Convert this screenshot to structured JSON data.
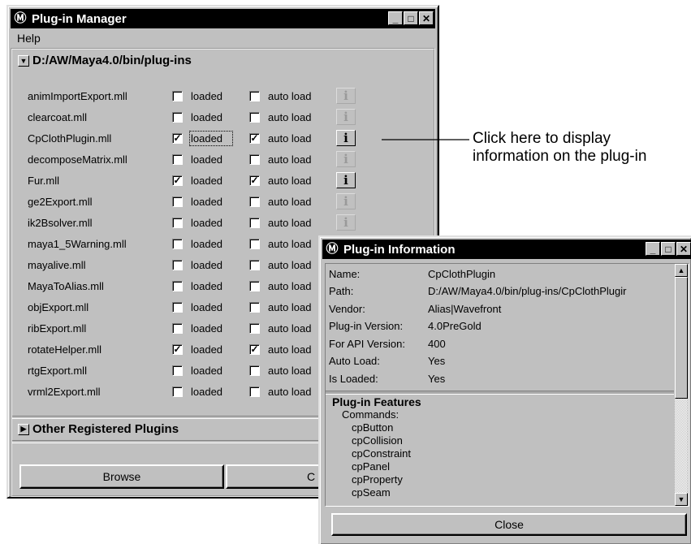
{
  "manager": {
    "title": "Plug-in Manager",
    "menu": "Help",
    "folder": "D:/AW/Maya4.0/bin/plug-ins",
    "loaded_label": "loaded",
    "autoload_label": "auto load",
    "info_glyph": "i",
    "plugins": [
      {
        "name": "animImportExport.mll",
        "loaded": false,
        "auto": false,
        "info": false
      },
      {
        "name": "clearcoat.mll",
        "loaded": false,
        "auto": false,
        "info": false
      },
      {
        "name": "CpClothPlugin.mll",
        "loaded": true,
        "auto": true,
        "info": true
      },
      {
        "name": "decomposeMatrix.mll",
        "loaded": false,
        "auto": false,
        "info": false
      },
      {
        "name": "Fur.mll",
        "loaded": true,
        "auto": true,
        "info": true
      },
      {
        "name": "ge2Export.mll",
        "loaded": false,
        "auto": false,
        "info": false
      },
      {
        "name": "ik2Bsolver.mll",
        "loaded": false,
        "auto": false,
        "info": false
      },
      {
        "name": "maya1_5Warning.mll",
        "loaded": false,
        "auto": false,
        "info": false
      },
      {
        "name": "mayalive.mll",
        "loaded": false,
        "auto": false,
        "info": false
      },
      {
        "name": "MayaToAlias.mll",
        "loaded": false,
        "auto": false,
        "info": false
      },
      {
        "name": "objExport.mll",
        "loaded": false,
        "auto": false,
        "info": false
      },
      {
        "name": "ribExport.mll",
        "loaded": false,
        "auto": false,
        "info": false
      },
      {
        "name": "rotateHelper.mll",
        "loaded": true,
        "auto": true,
        "info": false
      },
      {
        "name": "rtgExport.mll",
        "loaded": false,
        "auto": false,
        "info": false
      },
      {
        "name": "vrml2Export.mll",
        "loaded": false,
        "auto": false,
        "info": false
      }
    ],
    "other_section": "Other Registered Plugins",
    "browse_button": "Browse",
    "close_button_partial": "C"
  },
  "callout": {
    "line1": "Click here to display",
    "line2": "information on the plug-in"
  },
  "info_window": {
    "title": "Plug-in Information",
    "fields": [
      {
        "key": "Name:",
        "value": "CpClothPlugin"
      },
      {
        "key": "Path:",
        "value": "D:/AW/Maya4.0/bin/plug-ins/CpClothPlugir"
      },
      {
        "key": "Vendor:",
        "value": "Alias|Wavefront"
      },
      {
        "key": "Plug-in Version:",
        "value": "4.0PreGold"
      },
      {
        "key": "For API Version:",
        "value": "400"
      },
      {
        "key": "Auto Load:",
        "value": "Yes"
      },
      {
        "key": "Is Loaded:",
        "value": "Yes"
      }
    ],
    "features_heading": "Plug-in Features",
    "commands_label": "Commands:",
    "commands": [
      "cpButton",
      "cpCollision",
      "cpConstraint",
      "cpPanel",
      "cpProperty",
      "cpSeam"
    ],
    "close_button": "Close"
  }
}
